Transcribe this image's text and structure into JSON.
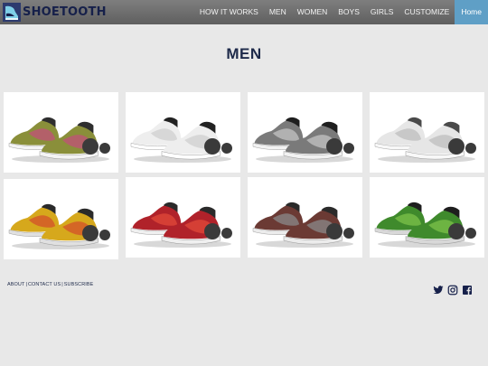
{
  "brand": {
    "name": "SHOETOOTH"
  },
  "nav": {
    "items": [
      {
        "label": "HOW IT WORKS"
      },
      {
        "label": "MEN"
      },
      {
        "label": "WOMEN"
      },
      {
        "label": "BOYS"
      },
      {
        "label": "GIRLS"
      },
      {
        "label": "CUSTOMIZE"
      },
      {
        "label": "Home"
      }
    ],
    "active_index": 6
  },
  "page": {
    "title": "MEN"
  },
  "products": [
    {
      "primary": "#8a8f3a",
      "secondary": "#c0507a",
      "sole": "#f4f4f4",
      "trim": "#2e2e2e"
    },
    {
      "primary": "#eeeeee",
      "secondary": "#cfcfcf",
      "sole": "#ffffff",
      "trim": "#222222"
    },
    {
      "primary": "#7a7a7a",
      "secondary": "#c4c4c4",
      "sole": "#f2f2f2",
      "trim": "#1e1e1e"
    },
    {
      "primary": "#e6e6e6",
      "secondary": "#bdbdbd",
      "sole": "#f8f8f8",
      "trim": "#4a4a4a"
    },
    {
      "primary": "#d6a81c",
      "secondary": "#d3502a",
      "sole": "#e0e0e0",
      "trim": "#2a2a2a"
    },
    {
      "primary": "#b0222a",
      "secondary": "#e24a3a",
      "sole": "#f0f0f0",
      "trim": "#2a2a2a"
    },
    {
      "primary": "#6b3a34",
      "secondary": "#8a8a8a",
      "sole": "#ececec",
      "trim": "#2a2a2a"
    },
    {
      "primary": "#3f8a2c",
      "secondary": "#7dc24a",
      "sole": "#d8d8d8",
      "trim": "#1e1e1e"
    }
  ],
  "footer": {
    "links": [
      "ABOUT",
      "CONTACT US",
      "SUBSCRIBE"
    ],
    "separator": "|",
    "social": [
      "twitter-icon",
      "instagram-icon",
      "facebook-icon"
    ]
  },
  "colors": {
    "nav_active": "#5f9fc6",
    "brand": "#16204a",
    "background": "#e8e8e8"
  }
}
